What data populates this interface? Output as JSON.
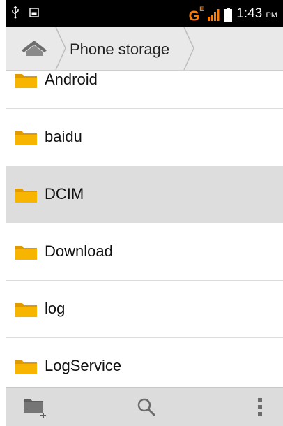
{
  "status_bar": {
    "network": "G",
    "network_sup": "E",
    "time": "1:43",
    "ampm": "PM"
  },
  "breadcrumb": {
    "current": "Phone storage"
  },
  "folders": [
    {
      "name": "Android"
    },
    {
      "name": "baidu"
    },
    {
      "name": "DCIM",
      "selected": true
    },
    {
      "name": "Download"
    },
    {
      "name": "log"
    },
    {
      "name": "LogService"
    }
  ],
  "colors": {
    "network_accent": "#ff7a00",
    "folder_fill": "#f7b500",
    "selected_row": "#dddddd"
  },
  "icons": {
    "home": "home-icon",
    "new_folder": "new-folder-icon",
    "search": "search-icon",
    "overflow": "overflow-menu-icon"
  }
}
